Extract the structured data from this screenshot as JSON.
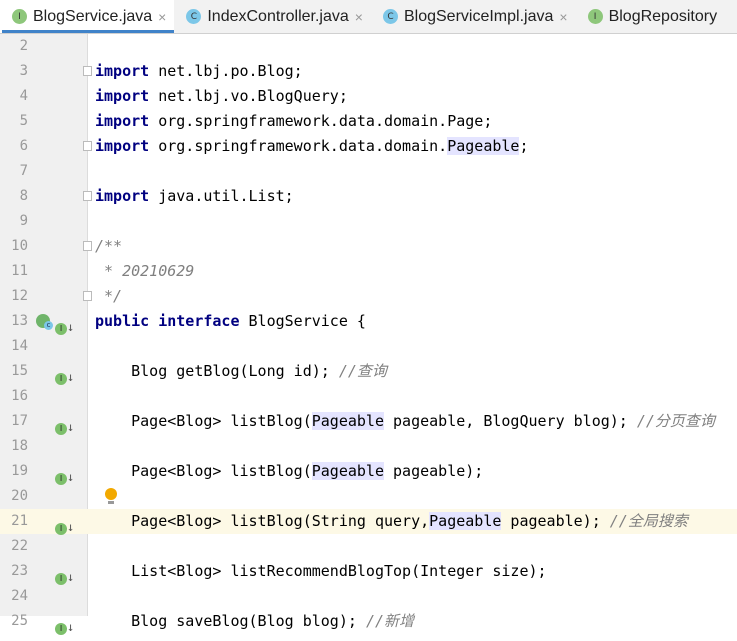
{
  "tabs": [
    {
      "label": "BlogService.java",
      "icon": "I",
      "kind": "interface",
      "active": true
    },
    {
      "label": "IndexController.java",
      "icon": "C",
      "kind": "class"
    },
    {
      "label": "BlogServiceImpl.java",
      "icon": "C",
      "kind": "class"
    },
    {
      "label": "BlogRepository",
      "icon": "I",
      "kind": "interface"
    }
  ],
  "close_glyph": "×",
  "current_line": 21,
  "lines": [
    {
      "n": "2",
      "seg": []
    },
    {
      "n": "3",
      "fold": true,
      "seg": [
        {
          "t": "import",
          "c": "kw"
        },
        {
          "t": " net.lbj.po.Blog;"
        }
      ]
    },
    {
      "n": "4",
      "seg": [
        {
          "t": "import",
          "c": "kw"
        },
        {
          "t": " net.lbj.vo.BlogQuery;"
        }
      ]
    },
    {
      "n": "5",
      "seg": [
        {
          "t": "import",
          "c": "kw"
        },
        {
          "t": " org.springframework.data.domain.Page;"
        }
      ]
    },
    {
      "n": "6",
      "fold": true,
      "seg": [
        {
          "t": "import",
          "c": "kw"
        },
        {
          "t": " org.springframework.data.domain."
        },
        {
          "t": "Pageable",
          "c": "hl"
        },
        {
          "t": ";"
        }
      ]
    },
    {
      "n": "7",
      "seg": []
    },
    {
      "n": "8",
      "fold": true,
      "seg": [
        {
          "t": "import",
          "c": "kw"
        },
        {
          "t": " java.util.List;"
        }
      ]
    },
    {
      "n": "9",
      "seg": []
    },
    {
      "n": "10",
      "fold": true,
      "seg": [
        {
          "t": "/**",
          "c": "cm"
        }
      ]
    },
    {
      "n": "11",
      "seg": [
        {
          "t": " * 20210629",
          "c": "cm"
        }
      ]
    },
    {
      "n": "12",
      "fold": true,
      "seg": [
        {
          "t": " */",
          "c": "cm"
        }
      ]
    },
    {
      "n": "13",
      "gutter": "implemented-both",
      "seg": [
        {
          "t": "public",
          "c": "kw"
        },
        {
          "t": " "
        },
        {
          "t": "interface",
          "c": "kw"
        },
        {
          "t": " BlogService {"
        }
      ]
    },
    {
      "n": "14",
      "seg": []
    },
    {
      "n": "15",
      "gutter": "implemented",
      "seg": [
        {
          "t": "    Blog getBlog(Long id); "
        },
        {
          "t": "//查询",
          "c": "cm"
        }
      ]
    },
    {
      "n": "16",
      "seg": []
    },
    {
      "n": "17",
      "gutter": "implemented",
      "seg": [
        {
          "t": "    Page<Blog> listBlog("
        },
        {
          "t": "Pageable",
          "c": "hl"
        },
        {
          "t": " pageable, BlogQuery blog); "
        },
        {
          "t": "//分页查询",
          "c": "cm"
        }
      ]
    },
    {
      "n": "18",
      "seg": []
    },
    {
      "n": "19",
      "gutter": "implemented",
      "seg": [
        {
          "t": "    Page<Blog> listBlog("
        },
        {
          "t": "Pageable",
          "c": "hl"
        },
        {
          "t": " pageable);"
        }
      ]
    },
    {
      "n": "20",
      "bulb": true,
      "seg": []
    },
    {
      "n": "21",
      "gutter": "implemented",
      "seg": [
        {
          "t": "    Page<Blog> listBlog(String query,"
        },
        {
          "t": "Pageable",
          "c": "hl"
        },
        {
          "t": " pageable); "
        },
        {
          "t": "//全局搜索",
          "c": "cm"
        }
      ]
    },
    {
      "n": "22",
      "seg": []
    },
    {
      "n": "23",
      "gutter": "implemented",
      "seg": [
        {
          "t": "    List<Blog> listRecommendBlogTop(Integer size);"
        }
      ]
    },
    {
      "n": "24",
      "seg": []
    },
    {
      "n": "25",
      "gutter": "implemented",
      "seg": [
        {
          "t": "    Blog saveBlog(Blog blog); "
        },
        {
          "t": "//新增",
          "c": "cm"
        }
      ]
    }
  ]
}
